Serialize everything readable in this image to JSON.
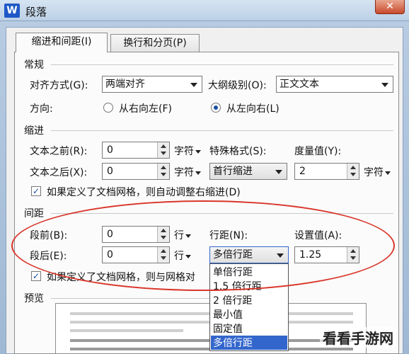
{
  "window": {
    "title": "段落",
    "app_icon": "W",
    "close_symbol": "✕"
  },
  "tabs": [
    {
      "label": "缩进和间距(I)",
      "active": true
    },
    {
      "label": "换行和分页(P)",
      "active": false
    }
  ],
  "general": {
    "title": "常规",
    "alignment_label": "对齐方式(G):",
    "alignment_value": "两端对齐",
    "outline_label": "大纲级别(O):",
    "outline_value": "正文文本",
    "direction_label": "方向:",
    "direction_rtl": "从右向左(F)",
    "direction_ltr": "从左向右(L)"
  },
  "indent": {
    "title": "缩进",
    "before_label": "文本之前(R):",
    "before_value": "0",
    "before_unit": "字符",
    "after_label": "文本之后(X):",
    "after_value": "0",
    "after_unit": "字符",
    "special_label": "特殊格式(S):",
    "special_value": "首行缩进",
    "measure_label": "度量值(Y):",
    "measure_value": "2",
    "measure_unit": "字符",
    "grid_check_label": "如果定义了文档网格，则自动调整右缩进(D)"
  },
  "spacing": {
    "title": "间距",
    "before_label": "段前(B):",
    "before_value": "0",
    "before_unit": "行",
    "after_label": "段后(E):",
    "after_value": "0",
    "after_unit": "行",
    "line_label": "行距(N):",
    "line_value": "多倍行距",
    "setvalue_label": "设置值(A):",
    "setvalue_value": "1.25",
    "grid_check_label": "如果定义了文档网格，则与网格对"
  },
  "line_spacing_options": [
    "单倍行距",
    "1.5 倍行距",
    "2 倍行距",
    "最小值",
    "固定值",
    "多倍行距"
  ],
  "line_spacing_selected_index": 5,
  "preview": {
    "title": "预览"
  },
  "watermark": "看看手游网",
  "colors": {
    "highlight": "#3366cc",
    "annotation": "#d9362b"
  }
}
